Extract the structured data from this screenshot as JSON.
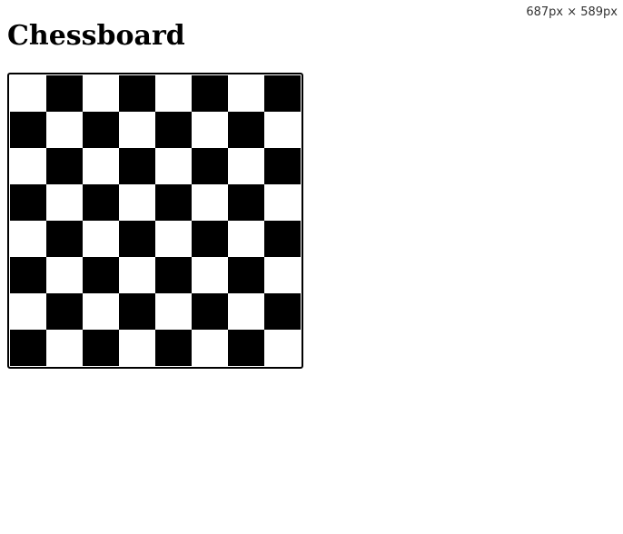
{
  "viewport_readout": "687px × 589px",
  "page": {
    "title": "Chessboard"
  },
  "board": {
    "rows": 8,
    "cols": 8,
    "top_left_color": "light",
    "colors": {
      "light": "#ffffff",
      "dark": "#000000",
      "border": "#000000"
    }
  }
}
